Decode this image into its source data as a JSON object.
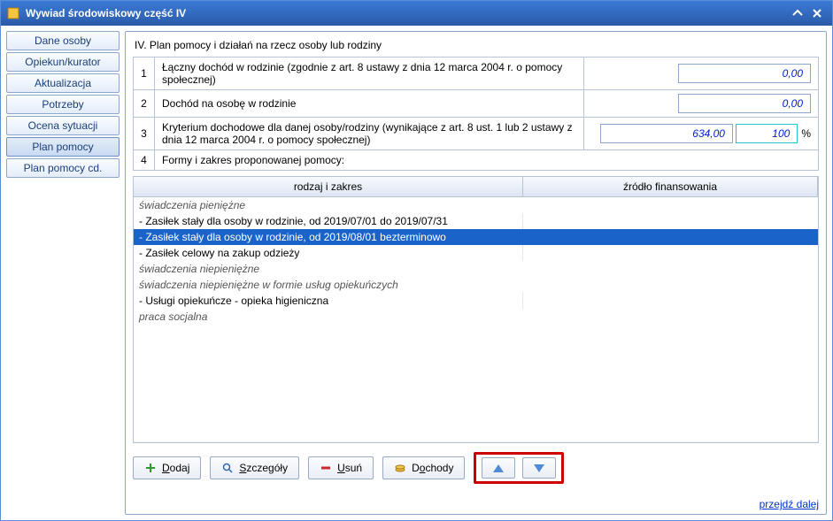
{
  "window": {
    "title": "Wywiad środowiskowy część IV"
  },
  "sidebar": {
    "items": [
      {
        "label": "Dane osoby"
      },
      {
        "label": "Opiekun/kurator"
      },
      {
        "label": "Aktualizacja"
      },
      {
        "label": "Potrzeby"
      },
      {
        "label": "Ocena sytuacji"
      },
      {
        "label": "Plan pomocy"
      },
      {
        "label": "Plan pomocy cd."
      }
    ],
    "selected_index": 5
  },
  "section": {
    "title": "IV. Plan pomocy i działań na rzecz osoby lub rodziny"
  },
  "rows": {
    "r1": {
      "num": "1",
      "label": "Łączny dochód w rodzinie (zgodnie z art. 8  ustawy z dnia 12 marca 2004 r. o pomocy społecznej)",
      "value": "0,00"
    },
    "r2": {
      "num": "2",
      "label": "Dochód na osobę w rodzinie",
      "value": "0,00"
    },
    "r3": {
      "num": "3",
      "label": "Kryterium dochodowe dla danej osoby/rodziny (wynikające z art. 8 ust. 1 lub 2 ustawy z dnia 12 marca 2004 r. o pomocy społecznej)",
      "value": "634,00",
      "pct": "100",
      "pct_suffix": "%"
    },
    "r4": {
      "num": "4",
      "label": "Formy i zakres proponowanej pomocy:"
    }
  },
  "list": {
    "headers": {
      "col1": "rodzaj i zakres",
      "col2": "źródło finansowania"
    },
    "rows": [
      {
        "type": "group",
        "label": "świadczenia pieniężne"
      },
      {
        "type": "item",
        "label": " - Zasiłek stały dla osoby w rodzinie,  od 2019/07/01 do 2019/07/31"
      },
      {
        "type": "item",
        "label": " - Zasiłek stały dla osoby w rodzinie,  od 2019/08/01 bezterminowo",
        "selected": true
      },
      {
        "type": "item",
        "label": " - Zasiłek celowy na zakup odzieży"
      },
      {
        "type": "group",
        "label": "świadczenia niepieniężne"
      },
      {
        "type": "group",
        "label": "świadczenia niepieniężne w formie usług opiekuńczych"
      },
      {
        "type": "item",
        "label": " - Usługi opiekuńcze - opieka higieniczna"
      },
      {
        "type": "group",
        "label": "praca socjalna"
      }
    ]
  },
  "toolbar": {
    "add": {
      "pre": "",
      "u": "D",
      "post": "odaj"
    },
    "details": {
      "pre": "",
      "u": "S",
      "post": "zczegóły"
    },
    "delete": {
      "pre": "",
      "u": "U",
      "post": "suń"
    },
    "income": {
      "pre": "D",
      "u": "o",
      "post": "chody"
    }
  },
  "footer": {
    "next": "przejdź dalej"
  }
}
